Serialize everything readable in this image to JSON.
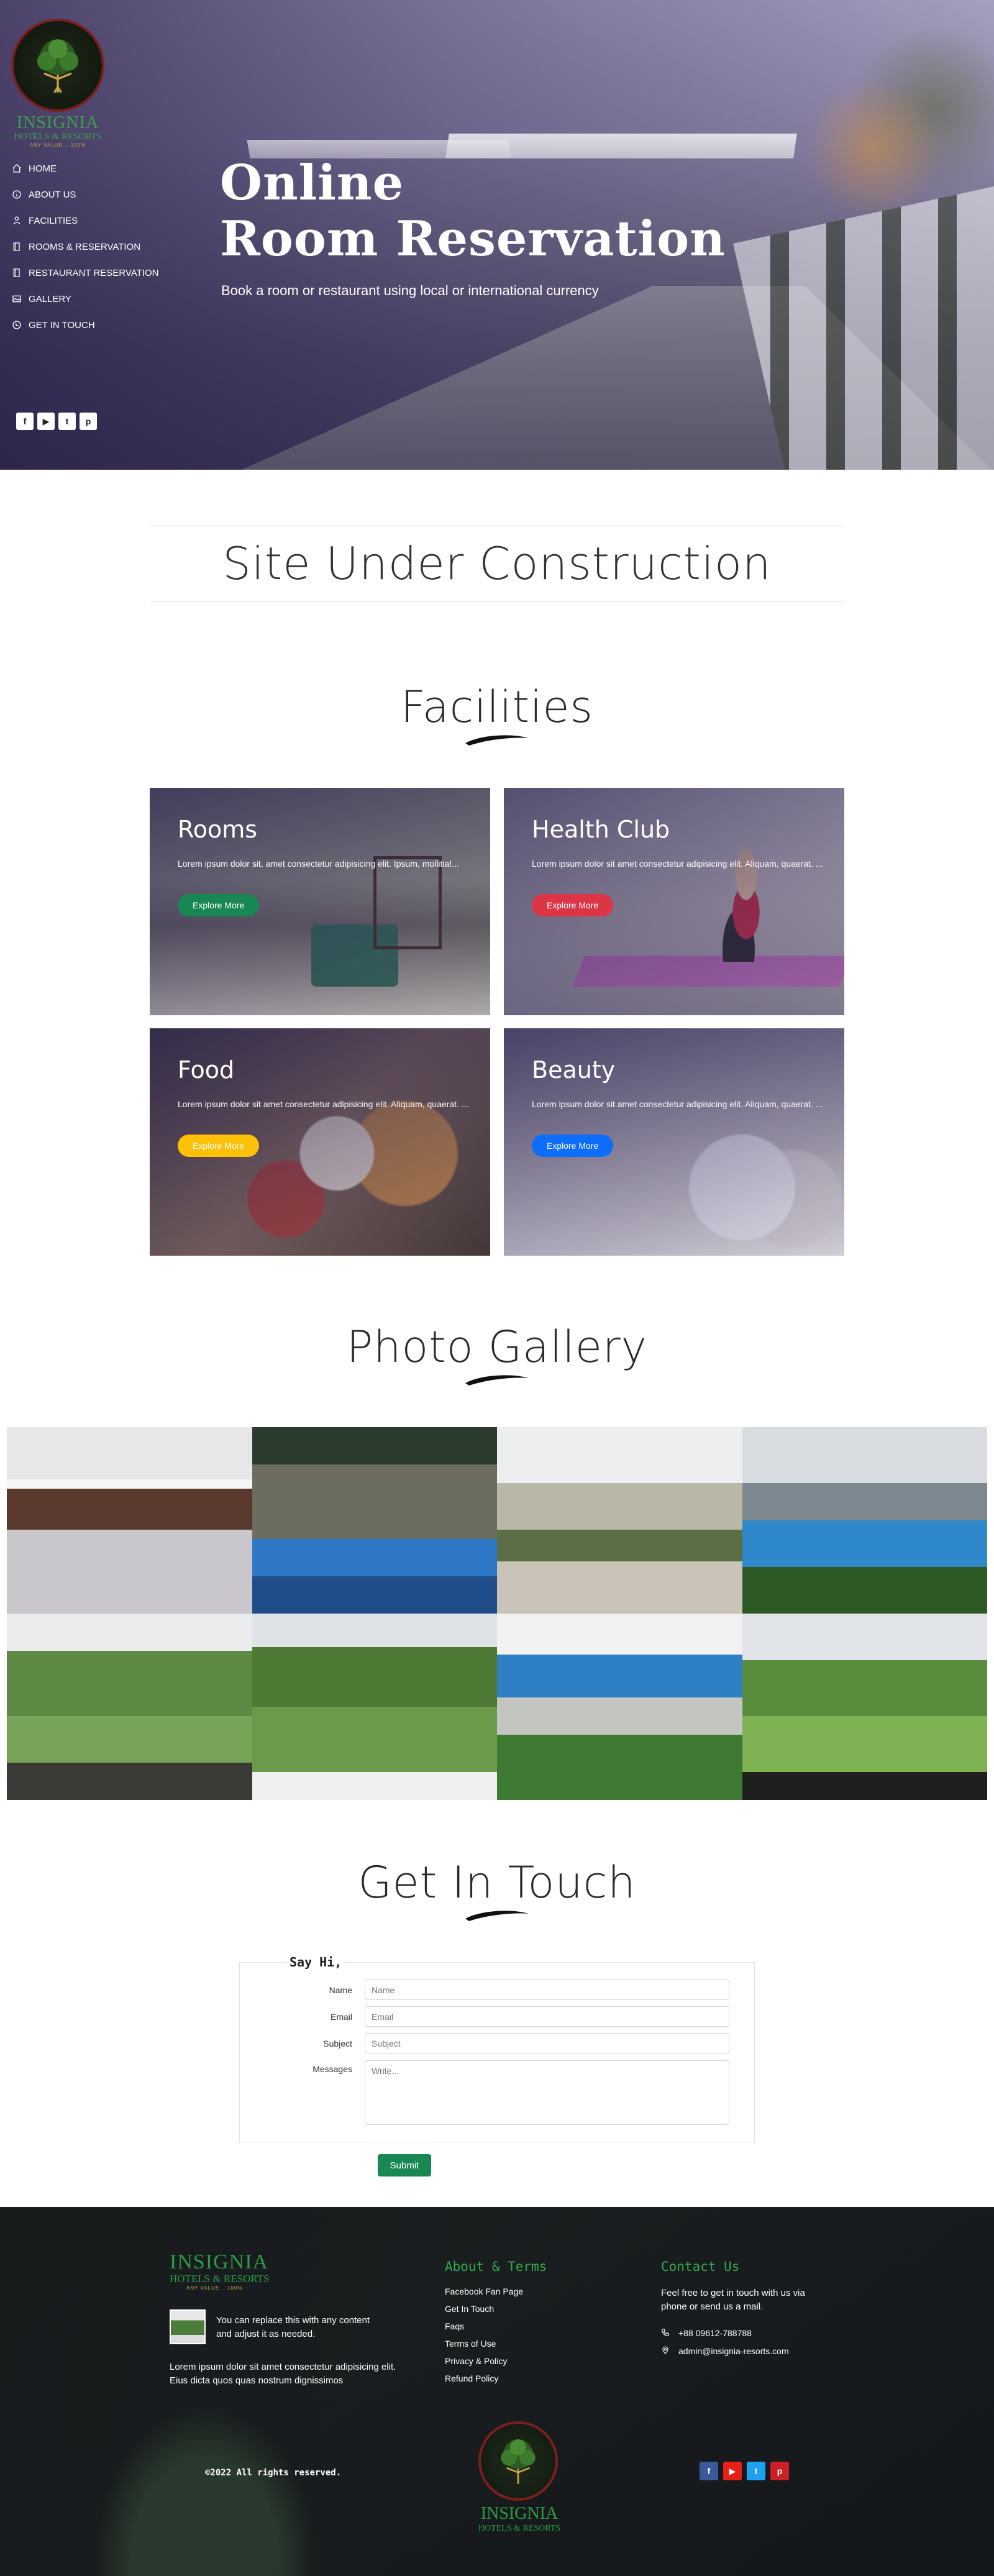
{
  "brand": {
    "name": "INSIGNIA",
    "sub": "HOTELS & RESORTS",
    "tag": "ANY VALUE... 100%"
  },
  "nav": [
    {
      "label": "HOME",
      "icon": "home-icon"
    },
    {
      "label": "ABOUT US",
      "icon": "info-icon"
    },
    {
      "label": "FACILITIES",
      "icon": "user-icon"
    },
    {
      "label": "ROOMS & RESERVATION",
      "icon": "book-icon"
    },
    {
      "label": "RESTAURANT RESERVATION",
      "icon": "book-icon"
    },
    {
      "label": "GALLERY",
      "icon": "image-icon"
    },
    {
      "label": "GET IN TOUCH",
      "icon": "phone-icon"
    }
  ],
  "hero_social": [
    "f",
    "▶",
    "t",
    "p"
  ],
  "hero": {
    "title_line1": "Online",
    "title_line2": "Room Reservation",
    "subtitle": "Book a room or restaurant using local or international currency"
  },
  "construction": "Site Under Construction",
  "facilities": {
    "title": "Facilities",
    "cards": [
      {
        "title": "Rooms",
        "text": "Lorem ipsum dolor sit, amet consectetur adipisicing elit. Ipsum, mollitia!...",
        "button": "Explore More",
        "color": "#198754"
      },
      {
        "title": "Health Club",
        "text": "Lorem ipsum dolor sit amet consectetur adipisicing elit. Aliquam, quaerat. ...",
        "button": "Explore More",
        "color": "#dc3545"
      },
      {
        "title": "Food",
        "text": "Lorem ipsum dolor sit amet consectetur adipisicing elit. Aliquam, quaerat. ...",
        "button": "Explore More",
        "color": "#ffc107"
      },
      {
        "title": "Beauty",
        "text": "Lorem ipsum dolor sit amet consectetur adipisicing elit. Aliquam, quaerat. ...",
        "button": "Explore More",
        "color": "#0d6efd"
      }
    ]
  },
  "gallery": {
    "title": "Photo Gallery"
  },
  "contact": {
    "title": "Get In Touch",
    "legend": "Say Hi,",
    "fields": [
      {
        "label": "Name",
        "placeholder": "Name"
      },
      {
        "label": "Email",
        "placeholder": "Email"
      },
      {
        "label": "Subject",
        "placeholder": "Subject"
      }
    ],
    "message_label": "Messages",
    "message_placeholder": "Write...",
    "submit": "Submit"
  },
  "footer": {
    "thumb_text": "You can replace this with any content and adjust it as needed.",
    "about": "Lorem ipsum dolor sit amet consectetur adipisicing elit. Eius dicta quos quas nostrum dignissimos",
    "links_title": "About & Terms",
    "links": [
      "Facebook Fan Page",
      "Get In Touch",
      "Faqs",
      "Terms of Use",
      "Privacy & Policy",
      "Refund Policy"
    ],
    "contact_title": "Contact Us",
    "contact_text": "Feel free to get in touch with us via phone or send us a mail.",
    "phone": "+88 09612-788788",
    "email": "admin@insignia-resorts.com",
    "copyright": "©2022 All rights reserved.",
    "social": [
      {
        "label": "f",
        "color": "#3b5998"
      },
      {
        "label": "▶",
        "color": "#e62117"
      },
      {
        "label": "t",
        "color": "#1da1f2"
      },
      {
        "label": "p",
        "color": "#cb2027"
      }
    ]
  }
}
